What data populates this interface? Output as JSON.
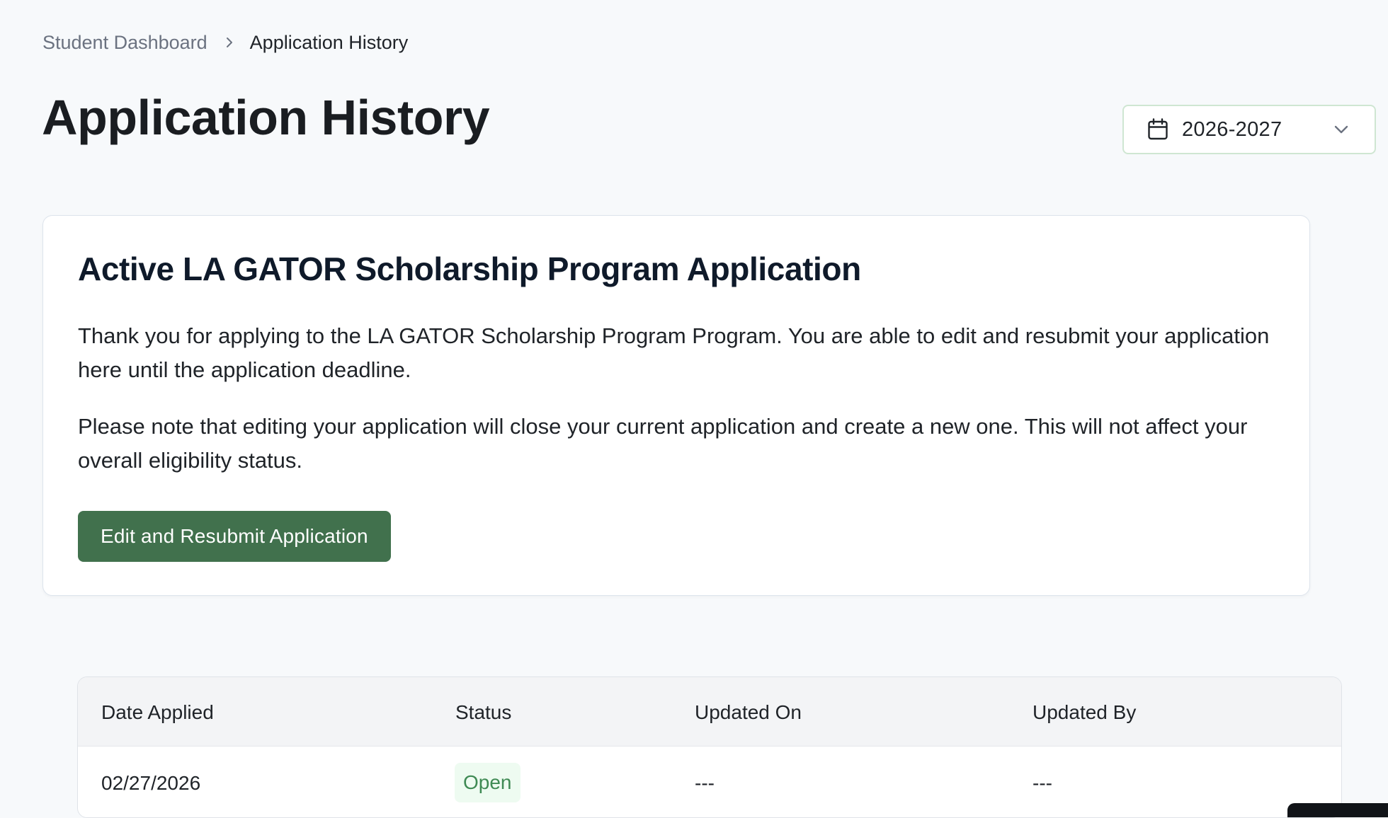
{
  "breadcrumb": {
    "parent": "Student Dashboard",
    "current": "Application History"
  },
  "page": {
    "title": "Application History"
  },
  "year_select": {
    "value": "2026-2027",
    "icon": "calendar-icon",
    "chevron_icon": "chevron-down-icon"
  },
  "card": {
    "title": "Active LA GATOR Scholarship Program Application",
    "paragraph1": "Thank you for applying to the LA GATOR Scholarship Program Program. You are able to edit and resubmit your application here until the application deadline.",
    "paragraph2": "Please note that editing your application will close your current application and create a new one. This will not affect your overall eligibility status.",
    "button_label": "Edit and Resubmit Application"
  },
  "table": {
    "headers": [
      "Date Applied",
      "Status",
      "Updated On",
      "Updated By"
    ],
    "rows": [
      {
        "date_applied": "02/27/2026",
        "status": "Open",
        "updated_on": "---",
        "updated_by": "---"
      }
    ]
  },
  "colors": {
    "background": "#f7f9fb",
    "primary_button": "#41714d",
    "status_open_bg": "#eefbf1",
    "status_open_text": "#3f8a54",
    "select_border": "#cfe6d2"
  }
}
